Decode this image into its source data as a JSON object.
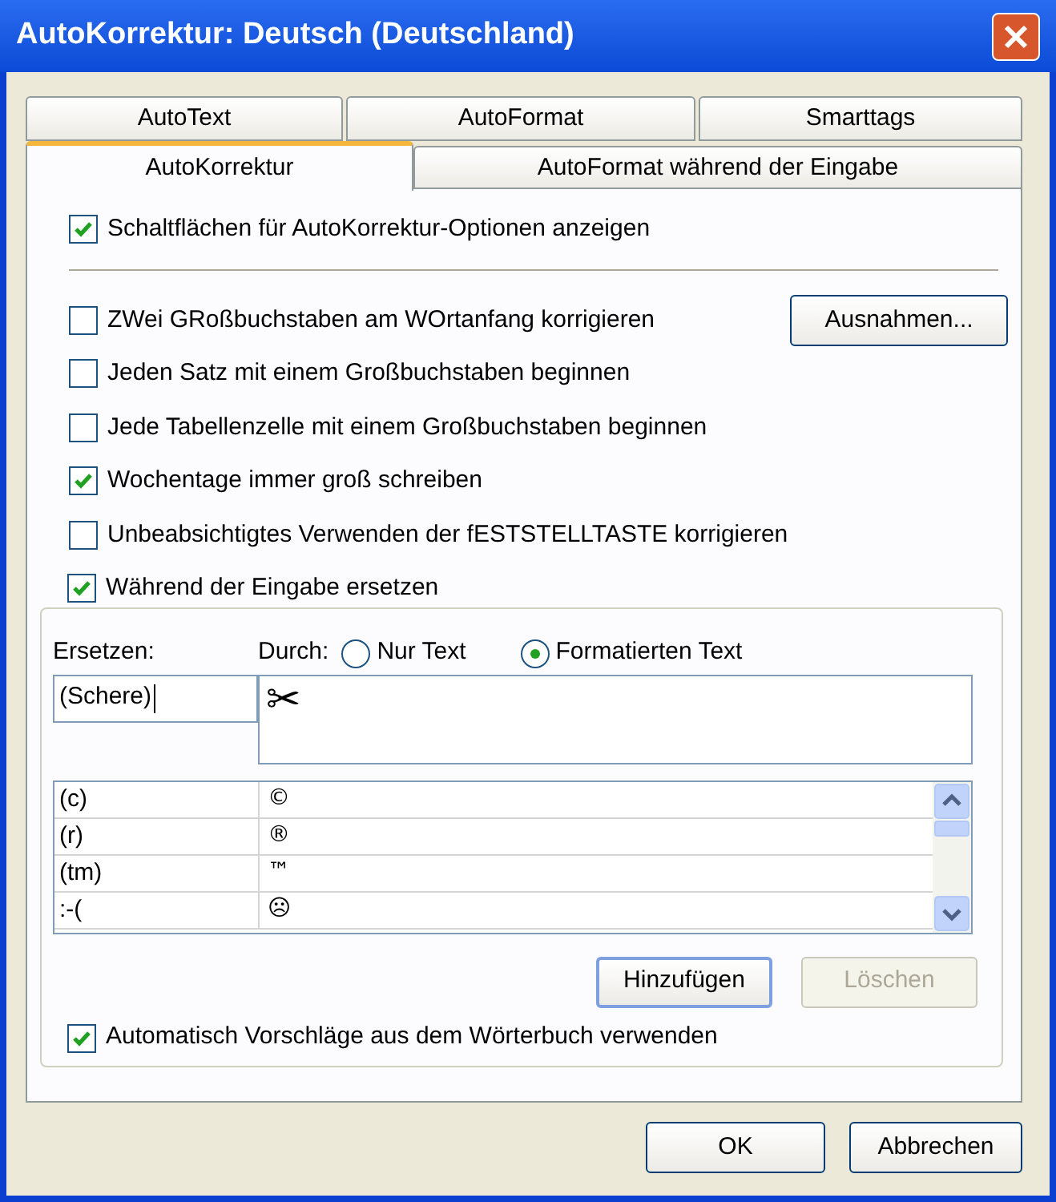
{
  "window": {
    "title": "AutoKorrektur: Deutsch (Deutschland)"
  },
  "tab_rows": [
    [
      {
        "label": "AutoText",
        "selected": false
      },
      {
        "label": "AutoFormat",
        "selected": false
      },
      {
        "label": "Smarttags",
        "selected": false
      }
    ],
    [
      {
        "label": "AutoKorrektur",
        "selected": true
      },
      {
        "label": "AutoFormat während der Eingabe",
        "selected": false
      }
    ]
  ],
  "top_option": {
    "label": "Schaltflächen für AutoKorrektur-Optionen anzeigen",
    "checked": true
  },
  "options": [
    {
      "label": "ZWei GRoßbuchstaben am WOrtanfang korrigieren",
      "checked": false
    },
    {
      "label": "Jeden Satz mit einem Großbuchstaben beginnen",
      "checked": false
    },
    {
      "label": "Jede Tabellenzelle mit einem Großbuchstaben beginnen",
      "checked": false
    },
    {
      "label": "Wochentage immer groß schreiben",
      "checked": true
    },
    {
      "label": "Unbeabsichtigtes Verwenden der fESTSTELLTASTE korrigieren",
      "checked": false
    }
  ],
  "exceptions_button": "Ausnahmen...",
  "replace_group": {
    "checkbox": {
      "label": "Während der Eingabe ersetzen",
      "checked": true
    },
    "replace_label": "Ersetzen:",
    "with_label": "Durch:",
    "format_options": [
      {
        "label": "Nur Text",
        "selected": false
      },
      {
        "label": "Formatierten Text",
        "selected": true
      }
    ],
    "replace_value": "(Schere)",
    "with_value": "✂",
    "rows": [
      {
        "replace": "(c)",
        "with": "©"
      },
      {
        "replace": "(r)",
        "with": "®"
      },
      {
        "replace": "(tm)",
        "with": "™"
      },
      {
        "replace": ":-(",
        "with": "☹"
      }
    ],
    "buttons": [
      {
        "label": "Hinzufügen",
        "disabled": false
      },
      {
        "label": "Löschen",
        "disabled": true
      }
    ],
    "suggest_checkbox": {
      "label": "Automatisch Vorschläge aus dem Wörterbuch verwenden",
      "checked": true
    }
  },
  "buttons": [
    "OK",
    "Abbrechen"
  ]
}
